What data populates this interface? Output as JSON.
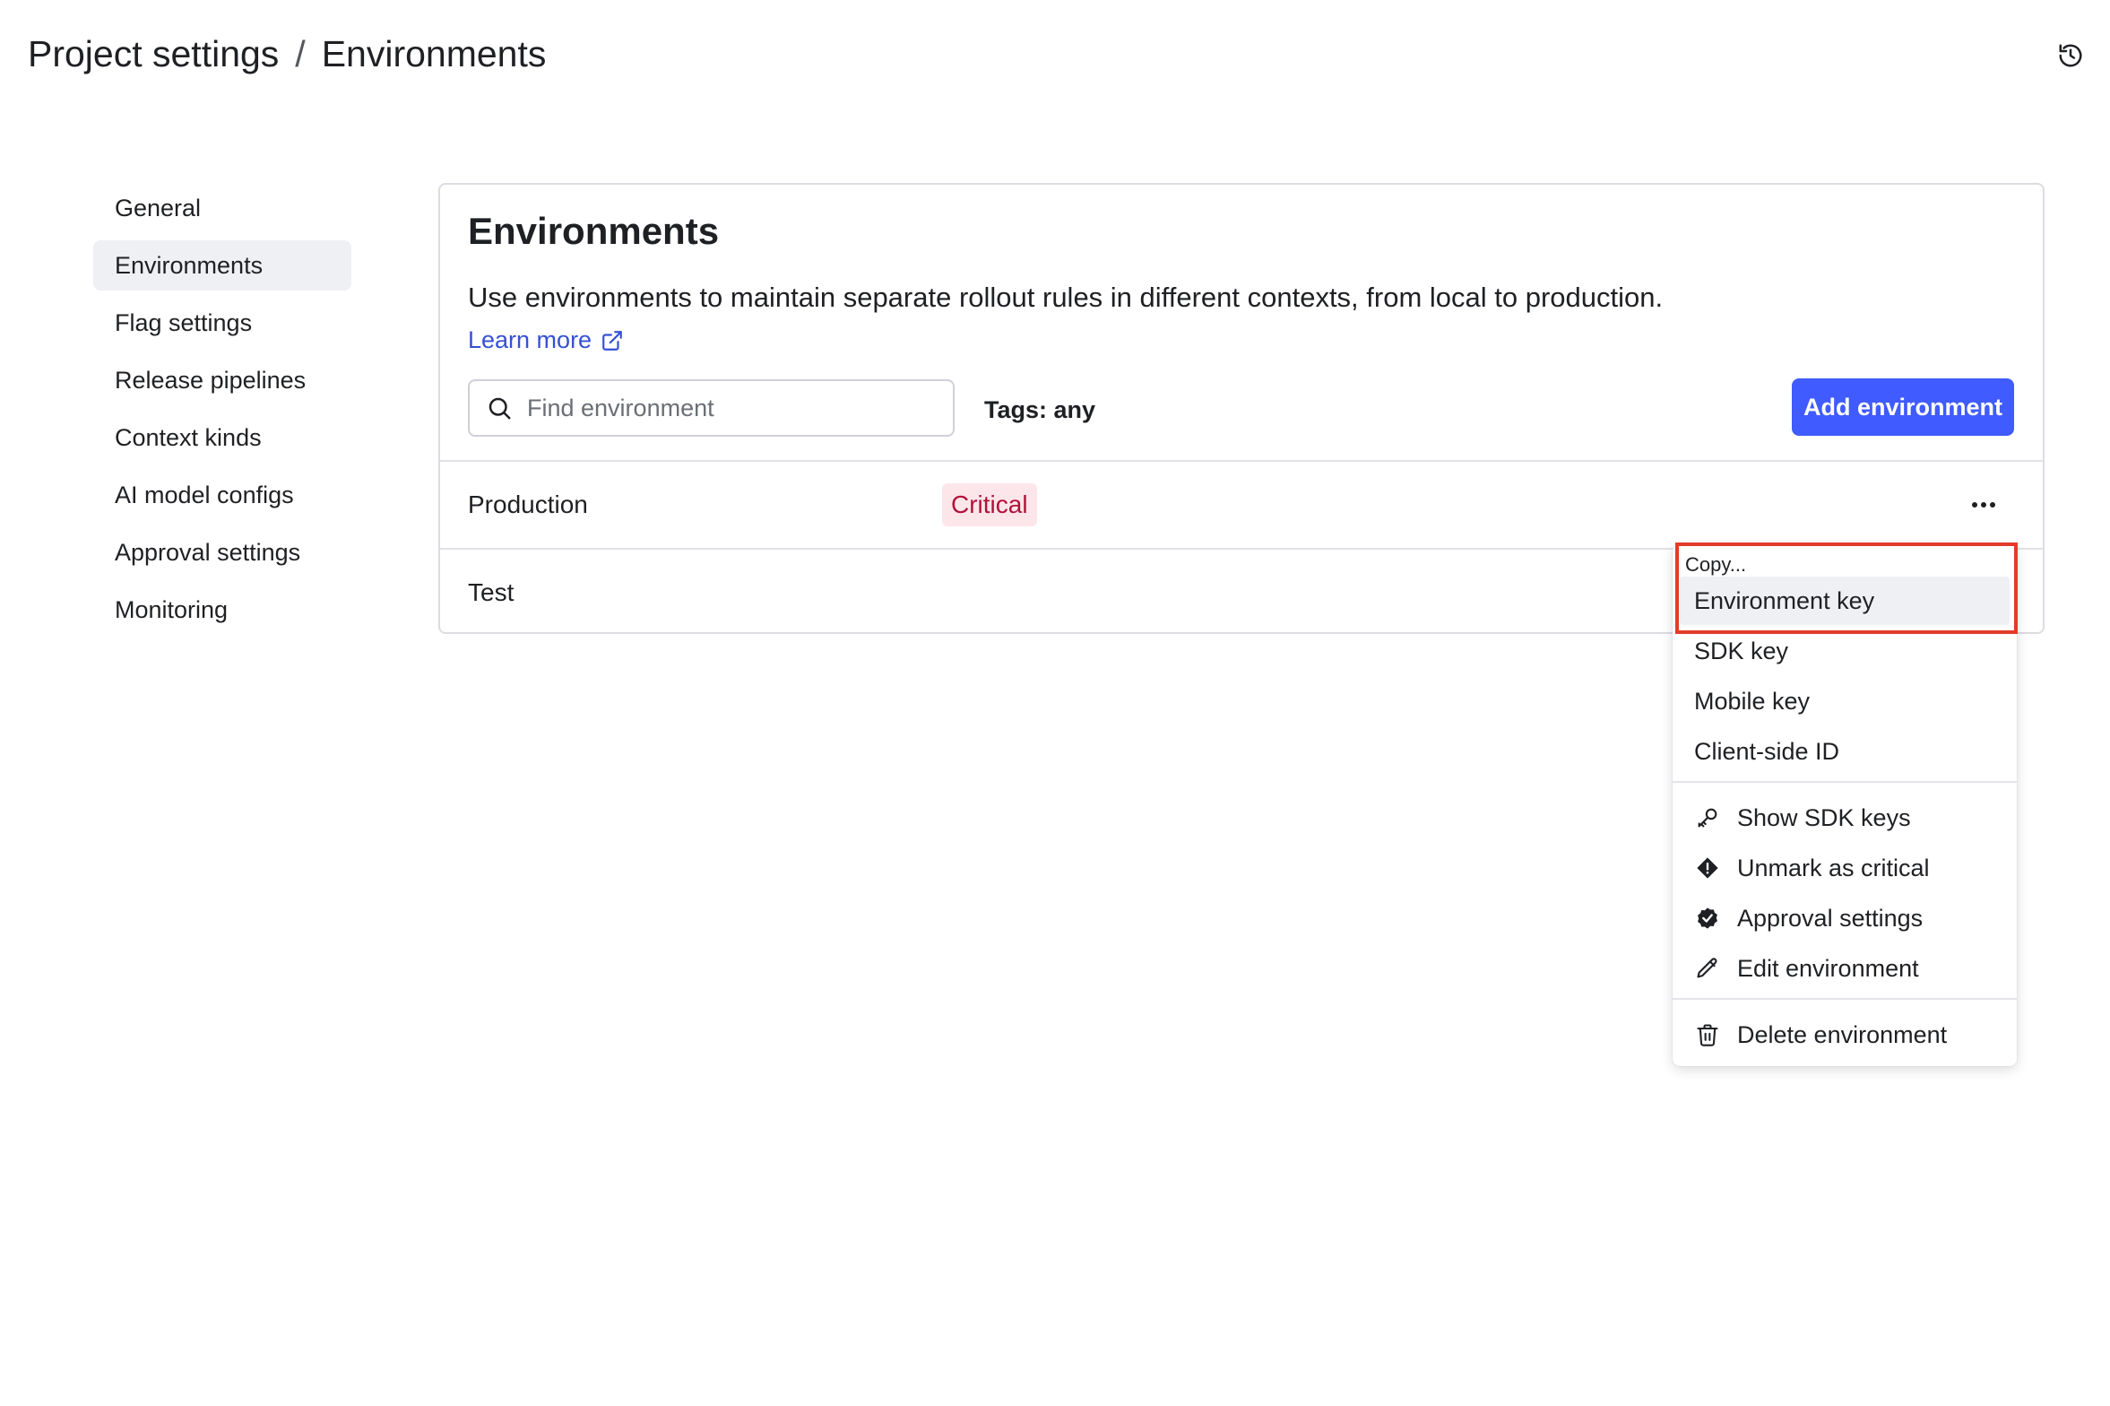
{
  "header": {
    "breadcrumb_parent": "Project settings",
    "breadcrumb_separator": "/",
    "breadcrumb_current": "Environments",
    "history_icon": "history-icon"
  },
  "sidebar": {
    "items": [
      {
        "label": "General"
      },
      {
        "label": "Environments",
        "active": true
      },
      {
        "label": "Flag settings"
      },
      {
        "label": "Release pipelines"
      },
      {
        "label": "Context kinds"
      },
      {
        "label": "AI model configs"
      },
      {
        "label": "Approval settings"
      },
      {
        "label": "Monitoring"
      }
    ]
  },
  "main": {
    "title": "Environments",
    "description": "Use environments to maintain separate rollout rules in different contexts, from local to production.",
    "learn_more": "Learn more",
    "search_placeholder": "Find environment",
    "tags_filter": "Tags: any",
    "add_button": "Add environment",
    "rows": [
      {
        "name": "Production",
        "badge": "Critical"
      },
      {
        "name": "Test"
      }
    ]
  },
  "menu": {
    "heading": "Copy...",
    "copy_items": [
      "Environment key",
      "SDK key",
      "Mobile key",
      "Client-side ID"
    ],
    "action_items": [
      {
        "label": "Show SDK keys",
        "icon": "key-icon"
      },
      {
        "label": "Unmark as critical",
        "icon": "alert-diamond-icon"
      },
      {
        "label": "Approval settings",
        "icon": "badge-check-icon"
      },
      {
        "label": "Edit environment",
        "icon": "pencil-icon"
      }
    ],
    "danger_item": {
      "label": "Delete environment",
      "icon": "trash-icon"
    }
  },
  "colors": {
    "accent": "#405bff",
    "link": "#3550d6",
    "critical_bg": "#fde6ea",
    "critical_text": "#b1123a",
    "highlight_box": "#e23c2b"
  }
}
